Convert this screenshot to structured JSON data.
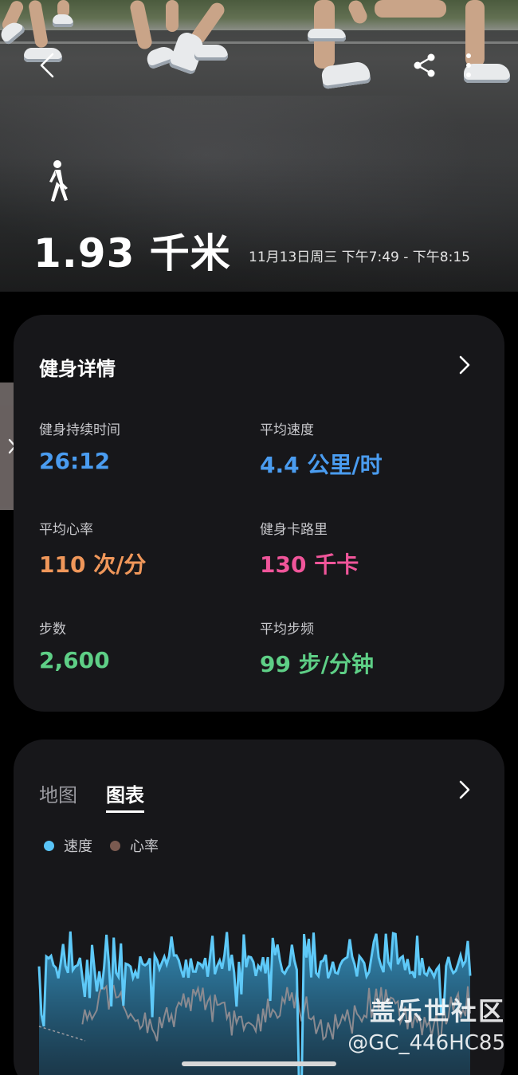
{
  "hero": {
    "distance": "1.93 千米",
    "time_range": "11月13日周三 下午7:49 - 下午8:15",
    "icons": {
      "back": "back-arrow-icon",
      "share": "share-icon",
      "more": "more-vertical-icon",
      "activity": "walking-person-icon"
    }
  },
  "details": {
    "title": "健身详情",
    "metrics": [
      {
        "label": "健身持续时间",
        "value": "26:12",
        "color": "#4a9cf0"
      },
      {
        "label": "平均速度",
        "value": "4.4 公里/时",
        "color": "#4a9cf0"
      },
      {
        "label": "平均心率",
        "value": "110 次/分",
        "color": "#f0975a"
      },
      {
        "label": "健身卡路里",
        "value": "130 千卡",
        "color": "#f0559a"
      },
      {
        "label": "步数",
        "value": "2,600",
        "color": "#5ecf86"
      },
      {
        "label": "平均步频",
        "value": "99 步/分钟",
        "color": "#5ecf86"
      }
    ]
  },
  "chart_card": {
    "tabs": [
      {
        "label": "地图",
        "active": false
      },
      {
        "label": "图表",
        "active": true
      }
    ],
    "legend": [
      {
        "label": "速度",
        "color": "#59c4f7"
      },
      {
        "label": "心率",
        "color": "#7a5a50"
      }
    ]
  },
  "watermark": {
    "line1": "盖乐世社区",
    "line2": "@GC_446HC85"
  }
}
